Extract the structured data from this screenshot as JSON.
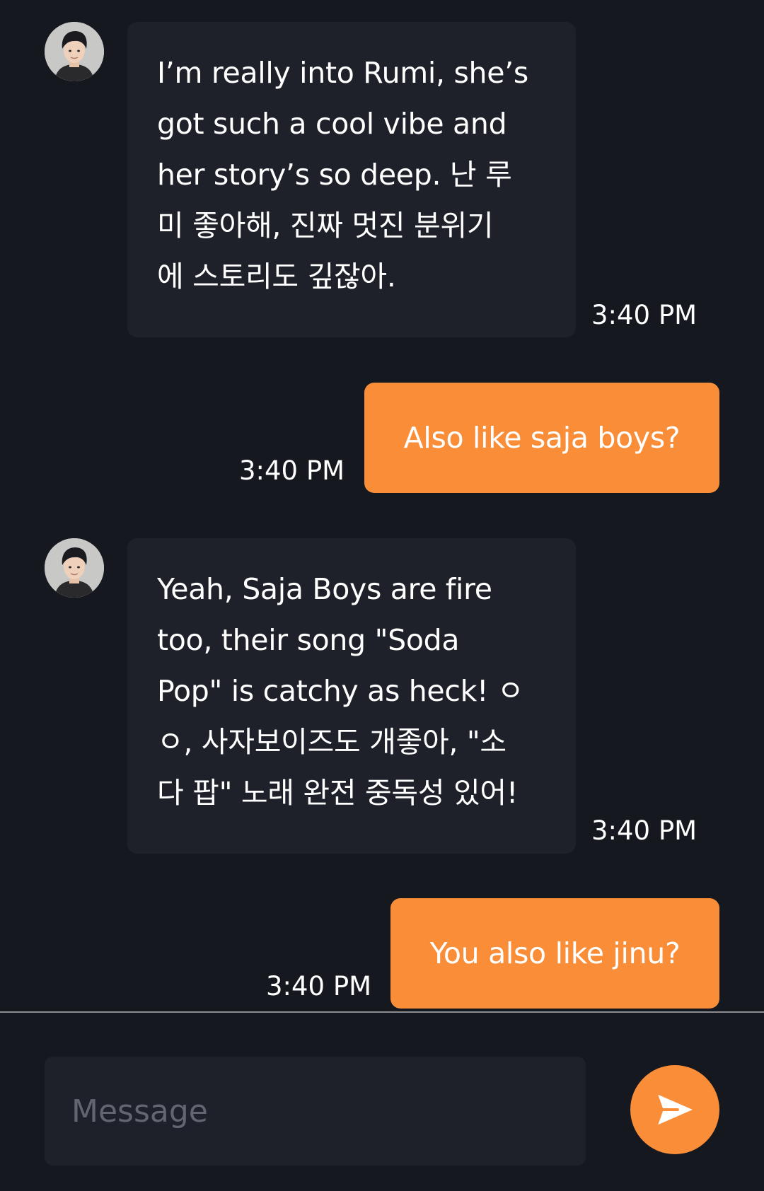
{
  "theme": {
    "background": "#16181f",
    "bot_bubble": "#1e212a",
    "user_bubble": "#f98d38",
    "accent": "#f98d38"
  },
  "messages": [
    {
      "sender": "bot",
      "text": "I’m really into Rumi, she’s\ngot such a cool vibe and\nher story’s so deep. 난 루\n미 좋아해, 진짜 멋진 분위기\n에 스토리도 깊잖아.",
      "time": "3:40 PM"
    },
    {
      "sender": "user",
      "text": "Also like saja boys?",
      "time": "3:40 PM"
    },
    {
      "sender": "bot",
      "text": "Yeah, Saja Boys are fire\ntoo, their song \"Soda\nPop\" is catchy as heck! ㅇ\nㅇ, 사자보이즈도 개좋아, \"소\n다 팝\" 노래 완전 중독성 있어!",
      "time": "3:40 PM"
    },
    {
      "sender": "user",
      "text": "You also like jinu?",
      "time": "3:40 PM"
    }
  ],
  "composer": {
    "placeholder": "Message",
    "value": "",
    "send_icon": "send-icon"
  }
}
